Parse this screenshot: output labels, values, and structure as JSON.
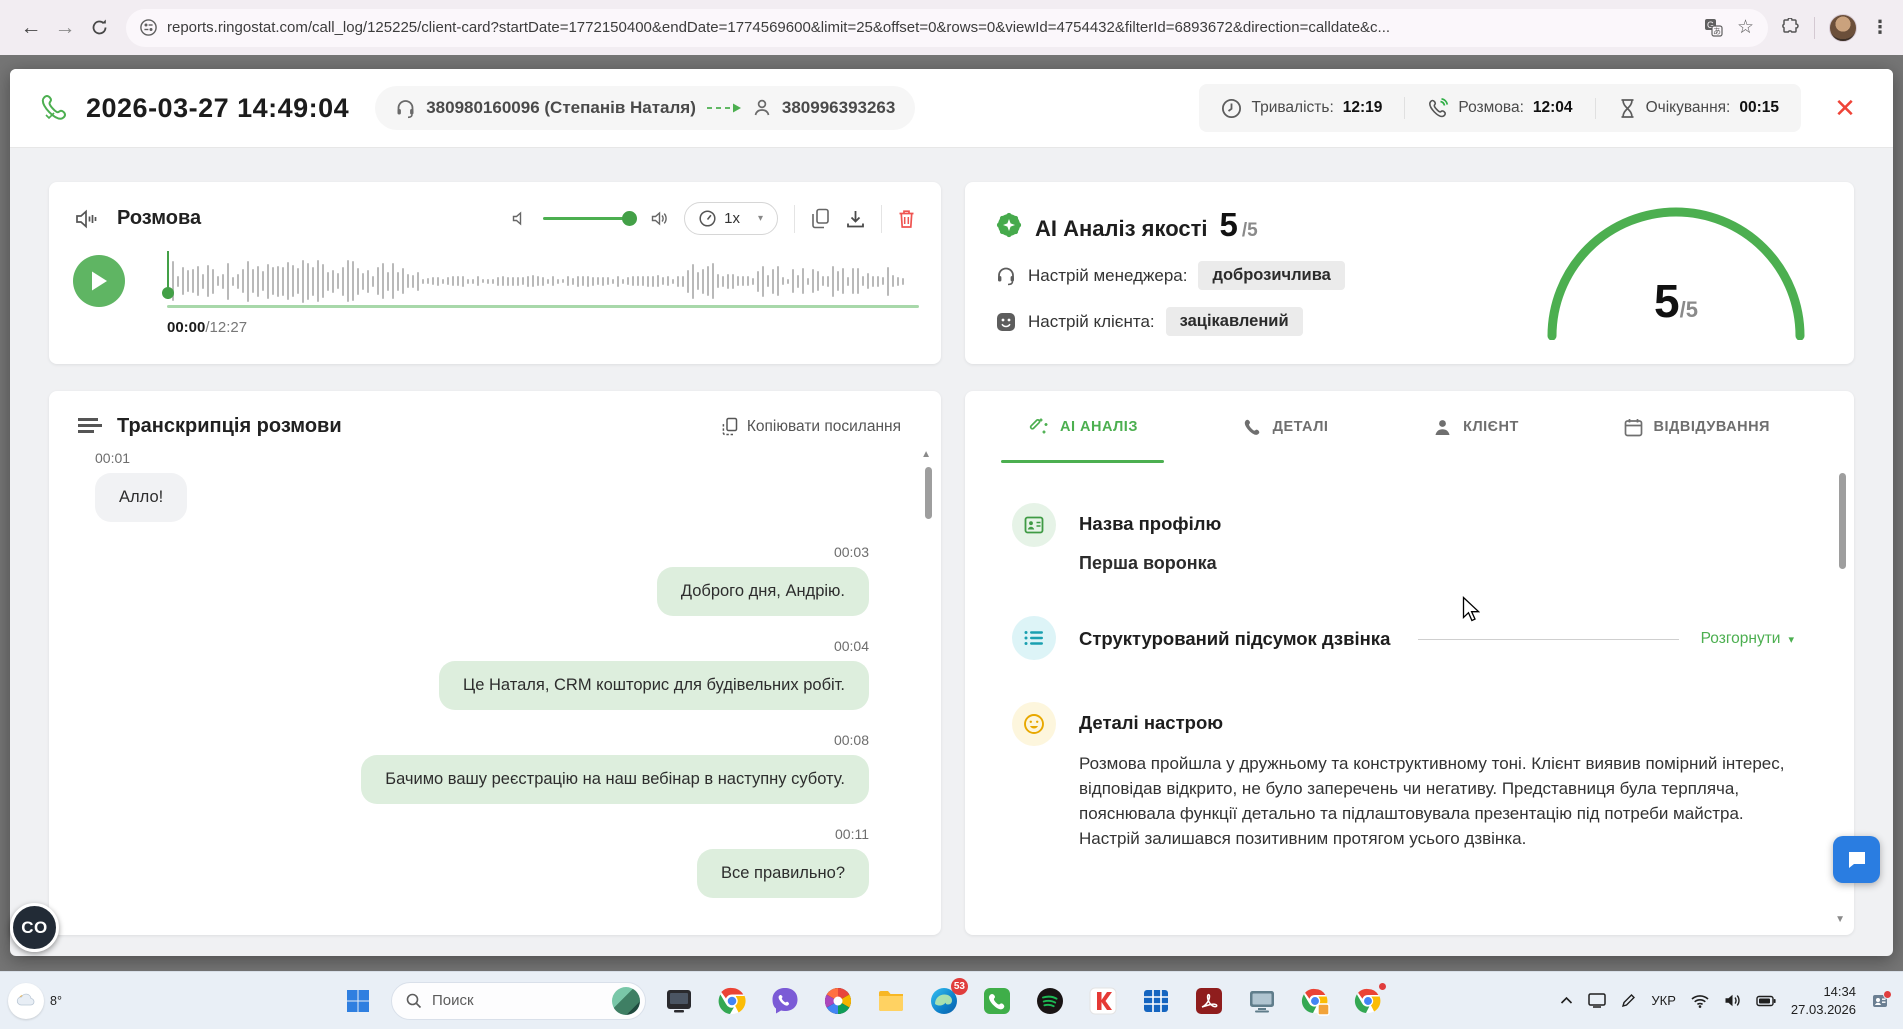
{
  "browser": {
    "url": "reports.ringostat.com/call_log/125225/client-card?startDate=1772150400&endDate=1774569600&limit=25&offset=0&rows=0&viewId=4754432&filterId=6893672&direction=calldate&c..."
  },
  "header": {
    "datetime": "2026-03-27 14:49:04",
    "from_number": "380980160096 (Степанів Наталя)",
    "to_number": "380996393263",
    "duration_label": "Тривалість:",
    "duration_value": "12:19",
    "talk_label": "Розмова:",
    "talk_value": "12:04",
    "wait_label": "Очікування:",
    "wait_value": "00:15",
    "close_glyph": "✕"
  },
  "player": {
    "title": "Розмова",
    "speed": "1x",
    "caret": "▾",
    "time_current": "00:00",
    "time_total": "/12:27"
  },
  "transcript": {
    "title": "Транскрипція розмови",
    "copy_link": "Копіювати посилання",
    "scroll_up": "▲",
    "messages": [
      {
        "time": "00:01",
        "text": "Алло!"
      },
      {
        "time": "00:03",
        "text": "Доброго дня, Андрію."
      },
      {
        "time": "00:04",
        "text": "Це Наталя, CRM кошторис для будівельних робіт."
      },
      {
        "time": "00:08",
        "text": "Бачимо вашу реєстрацію на наш вебінар в наступну суботу."
      },
      {
        "time": "00:11",
        "text": "Все правильно?"
      }
    ]
  },
  "quality": {
    "title": "AI Аналіз якості",
    "score": "5",
    "score_max": "/5",
    "manager_label": "Настрій менеджера:",
    "manager_mood": "доброзичлива",
    "client_label": "Настрій клієнта:",
    "client_mood": "зацікавлений",
    "gauge_score": "5",
    "gauge_max": "/5"
  },
  "tabs": {
    "ai": "AI АНАЛІЗ",
    "details": "ДЕТАЛІ",
    "client": "КЛІЄНТ",
    "visits": "ВІДВІДУВАННЯ"
  },
  "analysis": {
    "profile_title": "Назва профілю",
    "profile_value": "Перша воронка",
    "summary_title": "Структурований підсумок дзвінка",
    "expand_label": "Розгорнути",
    "expand_caret": "▾",
    "scroll_down": "▼",
    "mood_title": "Деталі настрою",
    "mood_text": "Розмова пройшла у дружньому та конструктивному тоні. Клієнт виявив помірний інтерес, відповідав відкрито, не було заперечень чи негативу. Представниця була терпляча, пояснювала функції детально та підлаштовувала презентацію під потреби майстра. Настрій залишався позитивним протягом усього дзвінка."
  },
  "widgets": {
    "co_label": "CO"
  },
  "taskbar": {
    "search_placeholder": "Поиск",
    "edge_badge": "53",
    "language": "УКР",
    "time": "14:34",
    "date": "27.03.2026",
    "weather_temp": "8°"
  },
  "colors": {
    "accent_green": "#4caf50",
    "danger_red": "#ef4438",
    "bubble_green": "#ddeedd",
    "bubble_gray": "#f1f2f4",
    "chip_gray": "#ebebeb"
  }
}
